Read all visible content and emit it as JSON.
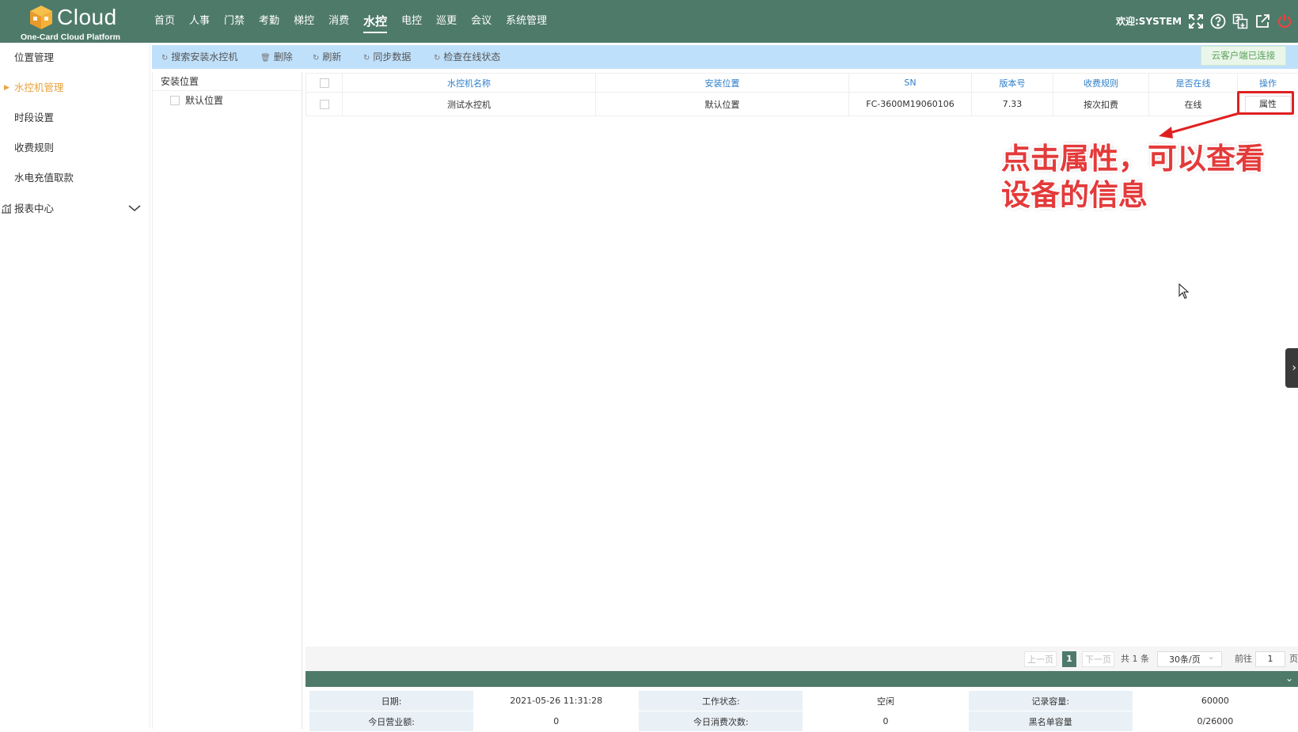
{
  "brand": {
    "name": "Cloud",
    "subtitle": "One-Card Cloud Platform"
  },
  "nav": [
    "首页",
    "人事",
    "门禁",
    "考勤",
    "梯控",
    "消费",
    "水控",
    "电控",
    "巡更",
    "会议",
    "系统管理"
  ],
  "nav_active": "水控",
  "welcome": "欢迎:SYSTEM",
  "top_icons": [
    "fullscreen-icon",
    "help-icon",
    "language-icon",
    "external-link-icon",
    "power-icon"
  ],
  "sidebar": {
    "items": [
      "位置管理",
      "水控机管理",
      "时段设置",
      "收费规则",
      "水电充值取款"
    ],
    "active": "水控机管理",
    "group": "报表中心"
  },
  "toolbar": {
    "search": "搜索安装水控机",
    "delete": "删除",
    "refresh": "刷新",
    "sync": "同步数据",
    "check": "检查在线状态",
    "status": "云客户端已连接"
  },
  "tree": {
    "header": "安装位置",
    "nodes": [
      "默认位置"
    ]
  },
  "table": {
    "columns": [
      "水控机名称",
      "安装位置",
      "SN",
      "版本号",
      "收费规则",
      "是否在线",
      "操作"
    ],
    "rows": [
      {
        "name": "测试水控机",
        "location": "默认位置",
        "sn": "FC-3600M19060106",
        "version": "7.33",
        "rule": "按次扣费",
        "online": "在线",
        "action": "属性"
      }
    ]
  },
  "annotation": {
    "line1": "点击属性，可以查看",
    "line2": "设备的信息",
    "color": "#e43a3a"
  },
  "pagination": {
    "prev": "上一页",
    "current": "1",
    "next": "下一页",
    "total": "共 1 条",
    "page_size": "30条/页",
    "goto_label": "前往",
    "goto_value": "1",
    "page_suffix": "页"
  },
  "detail": {
    "row1": [
      {
        "label": "日期:",
        "value": "2021-05-26 11:31:28"
      },
      {
        "label": "工作状态:",
        "value": "空闲"
      },
      {
        "label": "记录容量:",
        "value": "60000"
      }
    ],
    "row2": [
      {
        "label": "今日营业额:",
        "value": "0"
      },
      {
        "label": "今日消费次数:",
        "value": "0"
      },
      {
        "label": "黑名单容量",
        "value": "0/26000"
      }
    ]
  },
  "colors": {
    "header": "#4e7a6a",
    "toolbar": "#bfe0fb",
    "accent": "#e8a33c",
    "link": "#2f7fc9",
    "highlight": "#e02020"
  }
}
